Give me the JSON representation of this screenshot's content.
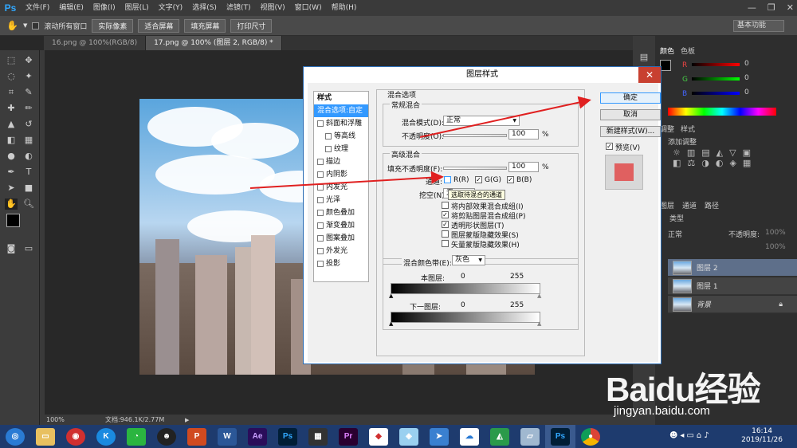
{
  "app": {
    "logo": "Ps"
  },
  "menu": [
    "文件(F)",
    "编辑(E)",
    "图像(I)",
    "图层(L)",
    "文字(Y)",
    "选择(S)",
    "滤镜(T)",
    "视图(V)",
    "窗口(W)",
    "帮助(H)"
  ],
  "options": {
    "scroll_all": "滚动所有窗口",
    "actual_pixels": "实际像素",
    "fit_screen": "适合屏幕",
    "fill_screen": "填充屏幕",
    "print_size": "打印尺寸",
    "workspace": "基本功能"
  },
  "tabs": [
    "16.png @ 100%(RGB/8)",
    "17.png @ 100% (图层 2, RGB/8) *"
  ],
  "status": {
    "zoom": "100%",
    "doc": "文档:946.1K/2.77M"
  },
  "panels": {
    "color_tab": "颜色",
    "swatch_tab": "色板",
    "adjust_tab": "调整",
    "styles_tab": "样式",
    "add_adjust": "添加调整",
    "layers_tab": "图层",
    "channels_tab": "通道",
    "paths_tab": "路径",
    "kind": "类型",
    "normal": "正常",
    "opacity": "不透明度:",
    "opacity_val": "100%",
    "fill_val": "100%",
    "channel_val": "0"
  },
  "layers": [
    "图层 2",
    "图层 1",
    "背景"
  ],
  "dialog": {
    "title": "图层样式",
    "styles_header": "样式",
    "style_items": [
      {
        "label": "混合选项:自定",
        "check": false,
        "selected": true
      },
      {
        "label": "斜面和浮雕",
        "check": true
      },
      {
        "label": "等高线",
        "check": true,
        "indent": true
      },
      {
        "label": "纹理",
        "check": true,
        "indent": true
      },
      {
        "label": "描边",
        "check": true
      },
      {
        "label": "内阴影",
        "check": true
      },
      {
        "label": "内发光",
        "check": true
      },
      {
        "label": "光泽",
        "check": true
      },
      {
        "label": "颜色叠加",
        "check": true
      },
      {
        "label": "渐变叠加",
        "check": true
      },
      {
        "label": "图案叠加",
        "check": true
      },
      {
        "label": "外发光",
        "check": true
      },
      {
        "label": "投影",
        "check": true
      }
    ],
    "blend_options": "混合选项",
    "general": "常规混合",
    "blend_mode_label": "混合模式(D):",
    "blend_mode": "正常",
    "opacity_label": "不透明度(O):",
    "opacity": "100",
    "pct": "%",
    "advanced": "高级混合",
    "fill_label": "填充不透明度(F):",
    "fill": "100",
    "channels_label": "通道:",
    "ch_r": "R(R)",
    "ch_g": "G(G)",
    "ch_b": "B(B)",
    "knockout_label": "挖空(N):",
    "knockout": "无",
    "tooltip": "选取待混合的通道",
    "opt1": "将内部效果混合成组(I)",
    "opt2": "将剪贴图层混合成组(P)",
    "opt3": "透明形状图层(T)",
    "opt4": "图层蒙版隐藏效果(S)",
    "opt5": "矢量蒙版隐藏效果(H)",
    "blendif_label": "混合颜色带(E):",
    "blendif": "灰色",
    "this_layer": "本图层:",
    "under_layer": "下一图层:",
    "v0": "0",
    "v255": "255",
    "ok": "确定",
    "cancel": "取消",
    "new_style": "新建样式(W)...",
    "preview": "预览(V)"
  },
  "taskbar": {
    "time": "16:14",
    "date": "2019/11/26"
  },
  "watermark": {
    "brand": "Baidu经验",
    "url": "jingyan.baidu.com"
  }
}
